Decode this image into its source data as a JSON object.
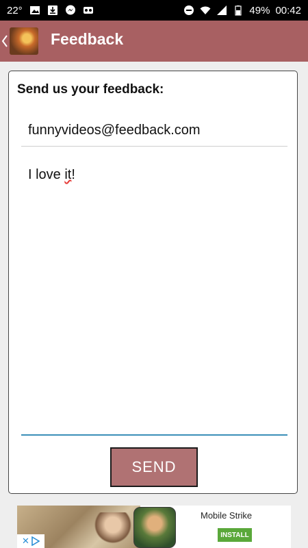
{
  "status_bar": {
    "temperature": "22°",
    "battery": "49%",
    "time": "00:42",
    "left_icons": [
      "image-icon",
      "download-icon",
      "messenger-icon",
      "mask-icon"
    ],
    "right_icons": [
      "do-not-disturb-icon",
      "wifi-icon",
      "signal-icon",
      "battery-icon"
    ]
  },
  "app_bar": {
    "title": "Feedback",
    "background_color": "#a86062"
  },
  "form": {
    "heading": "Send us your feedback:",
    "email_value": "funnyvideos@feedback.com",
    "message_prefix": "I love ",
    "message_misspelled": "it",
    "message_suffix": "!",
    "send_label": "SEND"
  },
  "ad": {
    "title": "Mobile Strike",
    "install_label": "INSTALL",
    "close_glyph": "✕"
  },
  "colors": {
    "accent": "#a86062",
    "button": "#b07273",
    "focus_underline": "#3a8fb8",
    "install": "#5aa83a"
  }
}
